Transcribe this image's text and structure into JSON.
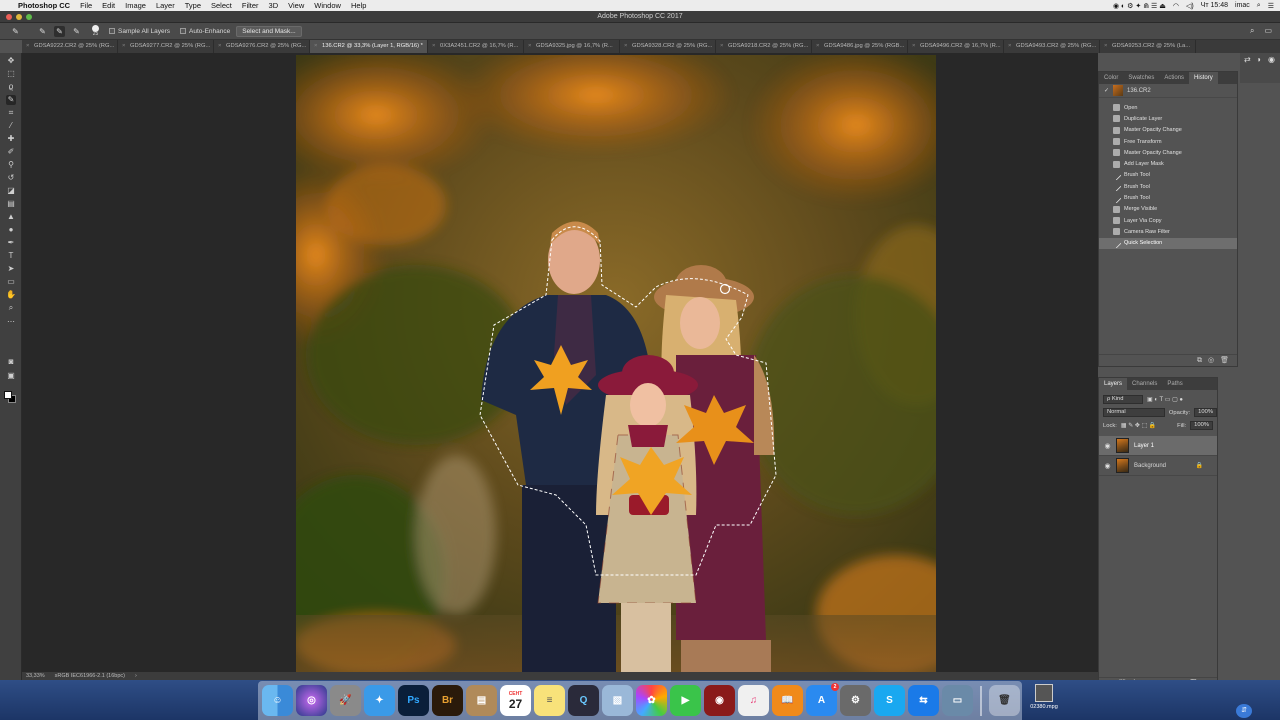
{
  "menubar": {
    "app": "Photoshop CC",
    "items": [
      "File",
      "Edit",
      "Image",
      "Layer",
      "Type",
      "Select",
      "Filter",
      "3D",
      "View",
      "Window",
      "Help"
    ],
    "clock": "Чт 15:48",
    "user": "imac"
  },
  "window": {
    "title": "Adobe Photoshop CC 2017"
  },
  "options": {
    "sample_all_layers": "Sample All Layers",
    "auto_enhance": "Auto-Enhance",
    "select_and_mask": "Select and Mask...",
    "brush_size": "25"
  },
  "doc_tabs": [
    {
      "label": "GDSA9222.CR2 @ 25% (RG..."
    },
    {
      "label": "GDSA9277.CR2 @ 25% (RG..."
    },
    {
      "label": "GDSA9276.CR2 @ 25% (RG..."
    },
    {
      "label": "136.CR2 @ 33,3% (Layer 1, RGB/16) *"
    },
    {
      "label": "0X3A2451.CR2 @ 16,7% (R..."
    },
    {
      "label": "GDSA9325.jpg @ 16,7% (R..."
    },
    {
      "label": "GDSA9328.CR2 @ 25% (RG..."
    },
    {
      "label": "GDSA9218.CR2 @ 25% (RG..."
    },
    {
      "label": "GDSA9486.jpg @ 25% (RGB..."
    },
    {
      "label": "GDSA9496.CR2 @ 16,7% (R..."
    },
    {
      "label": "GDSA9493.CR2 @ 25% (RG..."
    },
    {
      "label": "GDSA9253.CR2 @ 25% (La..."
    }
  ],
  "status": {
    "zoom": "33,33%",
    "profile": "sRGB IEC61966-2.1 (16bpc)"
  },
  "history_panel": {
    "tabs": [
      "Color",
      "Swatches",
      "Actions",
      "History"
    ],
    "snapshot": "136.CR2",
    "items": [
      {
        "label": "Open",
        "kind": "doc"
      },
      {
        "label": "Duplicate Layer",
        "kind": "doc"
      },
      {
        "label": "Master Opacity Change",
        "kind": "doc"
      },
      {
        "label": "Free Transform",
        "kind": "doc"
      },
      {
        "label": "Master Opacity Change",
        "kind": "doc"
      },
      {
        "label": "Add Layer Mask",
        "kind": "doc"
      },
      {
        "label": "Brush Tool",
        "kind": "brush"
      },
      {
        "label": "Brush Tool",
        "kind": "brush"
      },
      {
        "label": "Brush Tool",
        "kind": "brush"
      },
      {
        "label": "Merge Visible",
        "kind": "doc"
      },
      {
        "label": "Layer Via Copy",
        "kind": "doc"
      },
      {
        "label": "Camera Raw Filter",
        "kind": "doc"
      },
      {
        "label": "Quick Selection",
        "kind": "brush",
        "selected": true
      }
    ]
  },
  "layers_panel": {
    "tabs": [
      "Layers",
      "Channels",
      "Paths"
    ],
    "kind_label": "ρ Kind",
    "blend_mode": "Normal",
    "opacity_label": "Opacity:",
    "opacity_value": "100%",
    "lock_label": "Lock:",
    "fill_label": "Fill:",
    "fill_value": "100%",
    "layers": [
      {
        "name": "Layer 1",
        "selected": true
      },
      {
        "name": "Background",
        "selected": false
      }
    ]
  },
  "dock": {
    "calendar_day": "27",
    "calendar_month": "СЕНТ",
    "appstore_badge": "2",
    "file_label": "02380.mpg"
  }
}
